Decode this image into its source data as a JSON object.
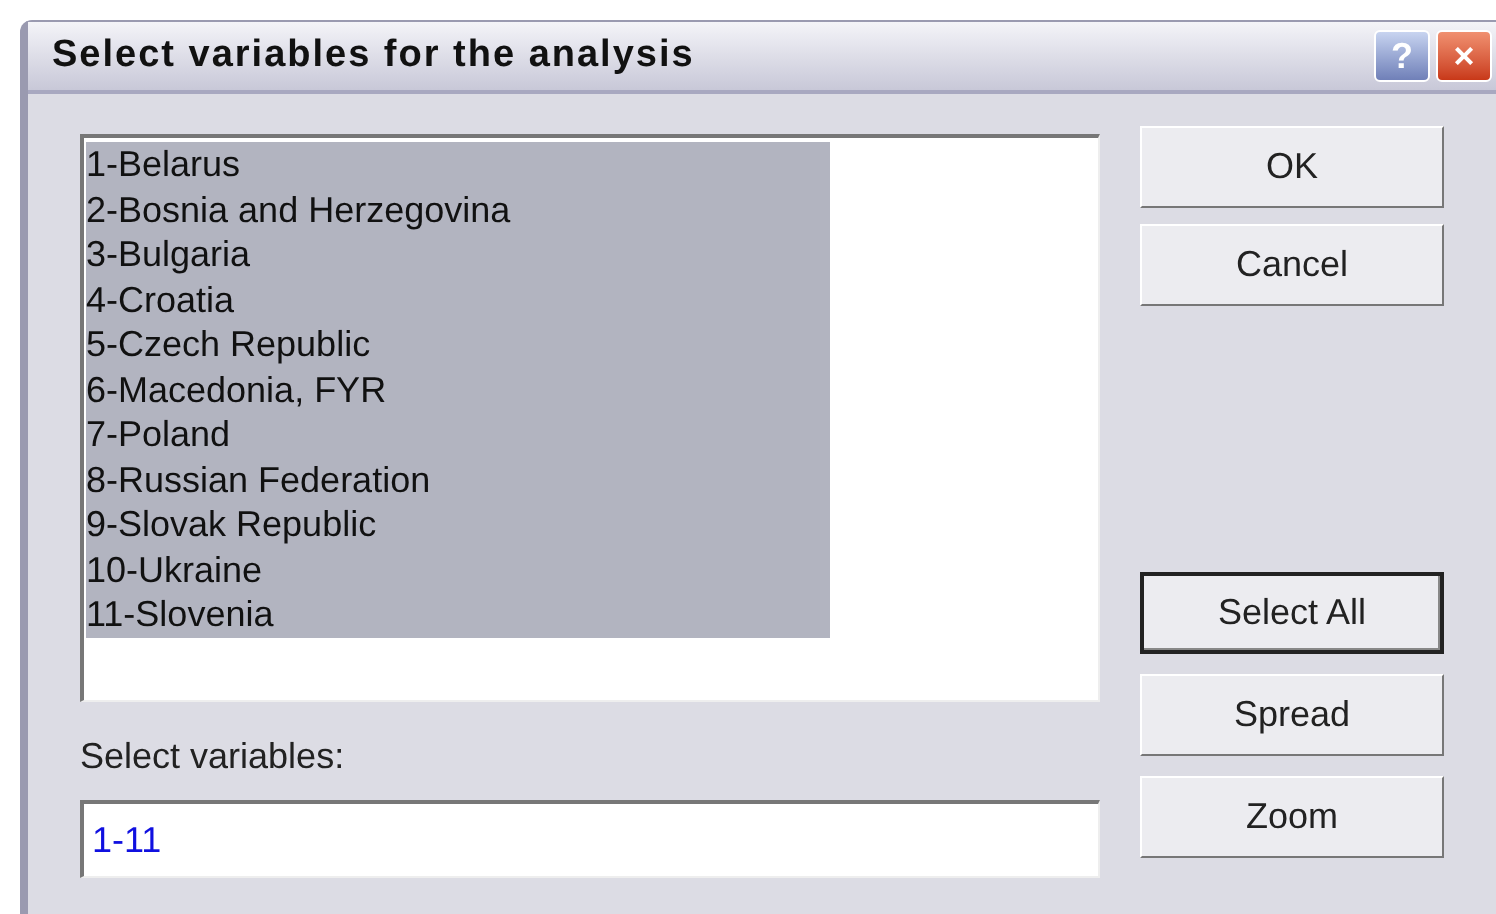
{
  "window": {
    "title": "Select variables for the analysis",
    "title_buttons": [
      {
        "kind": "help",
        "label": "?"
      },
      {
        "kind": "close",
        "label": "×"
      }
    ]
  },
  "variables_list": {
    "items": [
      {
        "label": "1-Belarus",
        "selected": true
      },
      {
        "label": "2-Bosnia and Herzegovina",
        "selected": true
      },
      {
        "label": "3-Bulgaria",
        "selected": true
      },
      {
        "label": "4-Croatia",
        "selected": true
      },
      {
        "label": "5-Czech Republic",
        "selected": true
      },
      {
        "label": "6-Macedonia, FYR",
        "selected": true
      },
      {
        "label": "7-Poland",
        "selected": true
      },
      {
        "label": "8-Russian Federation",
        "selected": true
      },
      {
        "label": "9-Slovak Republic",
        "selected": true
      },
      {
        "label": "10-Ukraine",
        "selected": true
      },
      {
        "label": "11-Slovenia",
        "selected": true
      }
    ]
  },
  "select_field": {
    "label": "Select variables:",
    "value": "1-11"
  },
  "top_buttons": [
    {
      "label": "OK",
      "focused": false
    },
    {
      "label": "Cancel",
      "focused": false
    }
  ],
  "bottom_buttons": [
    {
      "label": "Select All",
      "focused": true
    },
    {
      "label": "Spread",
      "focused": false
    },
    {
      "label": "Zoom",
      "focused": false
    }
  ]
}
